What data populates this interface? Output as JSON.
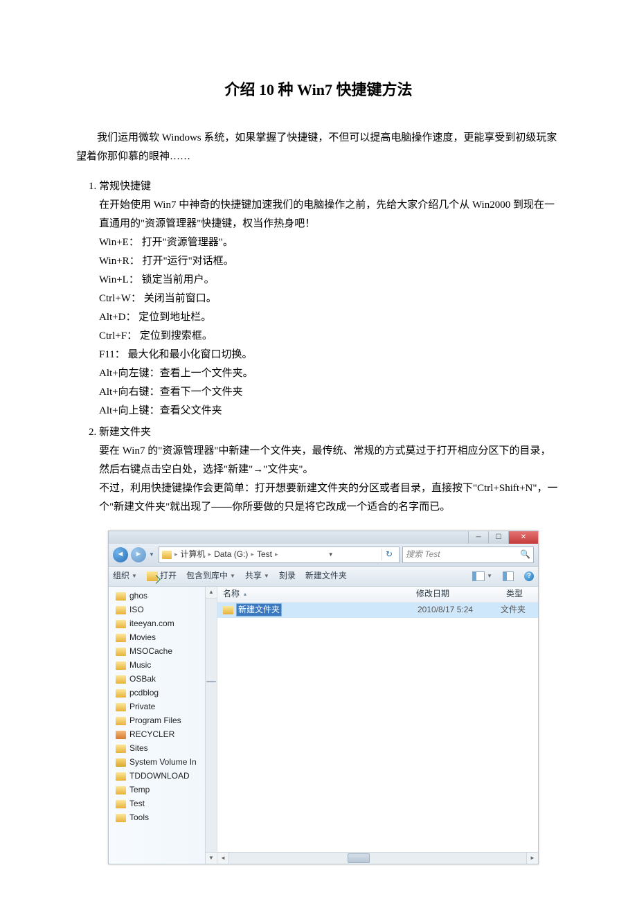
{
  "title": "介绍 10 种 Win7 快捷键方法",
  "intro": "我们运用微软 Windows 系统，如果掌握了快捷键，不但可以提高电脑操作速度，更能享受到初级玩家望着你那仰慕的眼神……",
  "sections": {
    "s1": {
      "heading": "常规快捷键",
      "lead": "在开始使用 Win7 中神奇的快捷键加速我们的电脑操作之前，先给大家介绍几个从 Win2000 到现在一直通用的\"资源管理器\"快捷键，权当作热身吧！",
      "lines": [
        "Win+E： 打开\"资源管理器\"。",
        "Win+R： 打开\"运行\"对话框。",
        "Win+L： 锁定当前用户。",
        "Ctrl+W： 关闭当前窗口。",
        "Alt+D： 定位到地址栏。",
        "Ctrl+F： 定位到搜索框。",
        "F11： 最大化和最小化窗口切换。",
        "Alt+向左键：查看上一个文件夹。",
        "Alt+向右键：查看下一个文件夹",
        "Alt+向上键：查看父文件夹"
      ]
    },
    "s2": {
      "heading": "新建文件夹",
      "p1": "要在 Win7 的\"资源管理器\"中新建一个文件夹，最传统、常规的方式莫过于打开相应分区下的目录，然后右键点击空白处，选择\"新建\"→\"文件夹\"。",
      "p2": "不过，利用快捷键操作会更简单：打开想要新建文件夹的分区或者目录，直接按下\"Ctrl+Shift+N\"，一个\"新建文件夹\"就出现了——你所要做的只是将它改成一个适合的名字而已。"
    }
  },
  "explorer": {
    "breadcrumb": {
      "seg1": "计算机",
      "seg2": "Data (G:)",
      "seg3": "Test"
    },
    "search_placeholder": "搜索 Test",
    "toolbar": {
      "organize": "组织",
      "open": "打开",
      "include": "包含到库中",
      "share": "共享",
      "burn": "刻录",
      "newfolder": "新建文件夹"
    },
    "columns": {
      "name": "名称",
      "date": "修改日期",
      "type": "类型"
    },
    "newfolder_name": "新建文件夹",
    "newfolder_date": "2010/8/17 5:24",
    "newfolder_type": "文件夹",
    "tree": [
      "ghos",
      "ISO",
      "iteeyan.com",
      "Movies",
      "MSOCache",
      "Music",
      "OSBak",
      "pcdblog",
      "Private",
      "Program Files",
      "RECYCLER",
      "Sites",
      "System Volume In",
      "TDDOWNLOAD",
      "Temp",
      "Test",
      "Tools"
    ]
  }
}
